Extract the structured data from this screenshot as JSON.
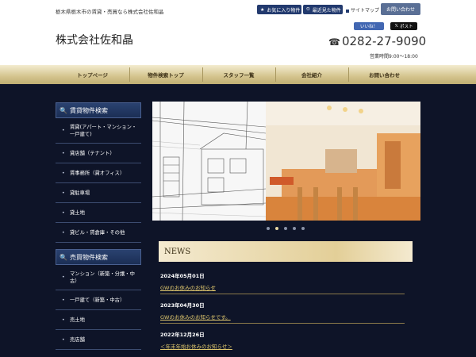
{
  "header": {
    "tagline": "栃木県栃木市の賃貸・売買なら株式会社佐和晶",
    "favorites_label": "お気に入り物件",
    "recent_label": "最近見た物件",
    "sitemap_label": "サイトマップ",
    "contact_label": "お問い合わせ",
    "brand": "株式会社佐和晶",
    "fb_label": "いいね！",
    "x_label": "ポスト",
    "phone": "0282-27-9090",
    "hours": "営業時間9:00～18:00"
  },
  "nav": [
    "トップページ",
    "物件検索トップ",
    "スタッフ一覧",
    "会社紹介",
    "お問い合わせ"
  ],
  "rent": {
    "title": "賃貸物件検索",
    "items": [
      "賃貸(アパート・マンション・一戸建て)",
      "貸店舗（テナント）",
      "賃事務所（貸オフィス）",
      "貸駐車場",
      "貸土地",
      "貸ビル・賃倉庫・その他"
    ]
  },
  "sale": {
    "title": "売買物件検索",
    "items": [
      "マンション（新築・分譲・中古）",
      "一戸建て（新築・中古）",
      "売土地",
      "売店舗"
    ]
  },
  "slider": {
    "active_index": 1,
    "count": 5
  },
  "news": {
    "title": "NEWS",
    "items": [
      {
        "date": "2024年05月01日",
        "text": "GWのお休みのお知らせ"
      },
      {
        "date": "2023年04月30日",
        "text": "GWのお休みのお知らせです。"
      },
      {
        "date": "2022年12月26日",
        "text": "＜年末年始お休みのお知らせ＞"
      }
    ]
  }
}
